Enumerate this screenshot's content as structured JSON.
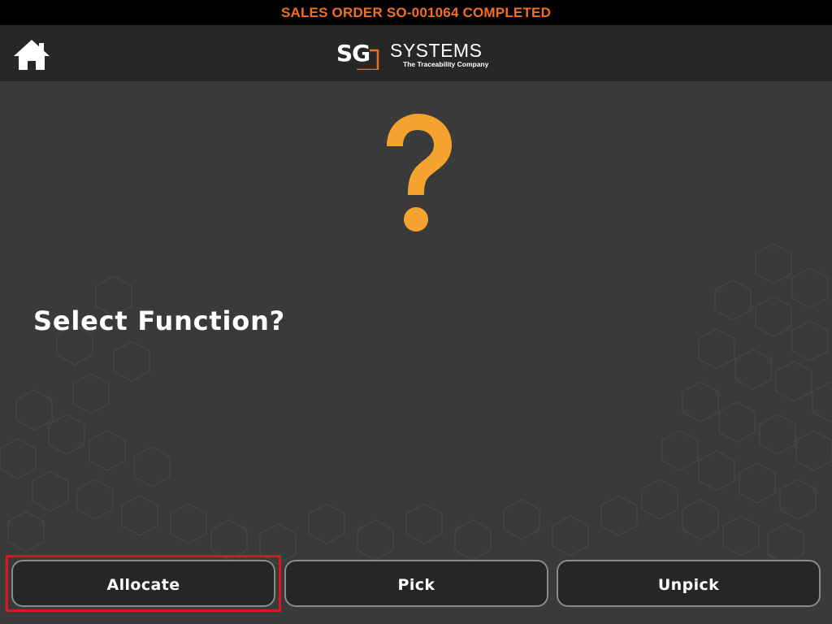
{
  "status_bar": {
    "text": "SALES ORDER SO-001064 COMPLETED",
    "color": "#f26f1f"
  },
  "header": {
    "home_icon": "home-icon",
    "logo": {
      "mark": "SG",
      "name": "SYSTEMS",
      "tagline": "The Traceability Company",
      "accent_color": "#e8702a"
    }
  },
  "main": {
    "icon": "question-mark-icon",
    "icon_color": "#f5a22e",
    "prompt": "Select Function?"
  },
  "actions": {
    "buttons": [
      {
        "label": "Allocate",
        "highlighted": true
      },
      {
        "label": "Pick",
        "highlighted": false
      },
      {
        "label": "Unpick",
        "highlighted": false
      }
    ],
    "highlight_color": "#e0141b"
  }
}
